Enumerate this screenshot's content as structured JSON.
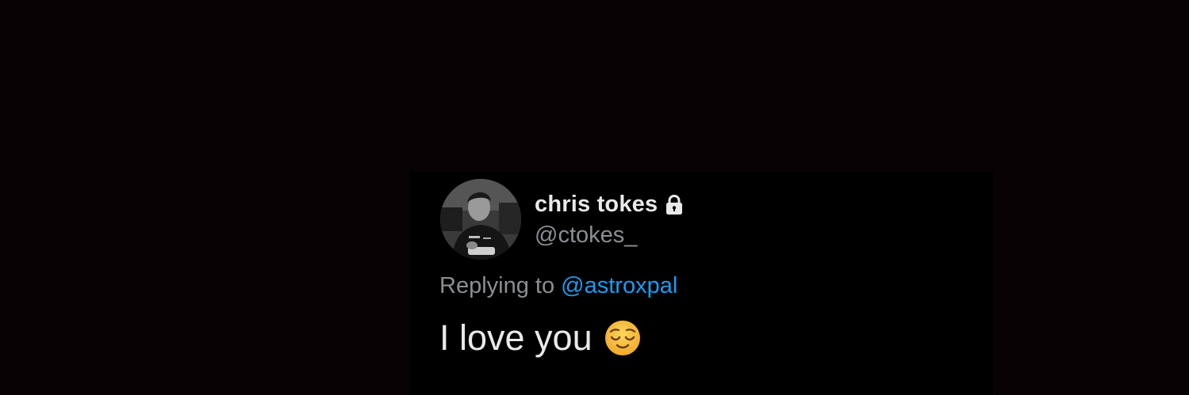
{
  "tweet": {
    "display_name": "chris tokes",
    "handle": "@ctokes_",
    "reply_prefix": "Replying to",
    "reply_mention": "@astroxpal",
    "text": "I love you",
    "emoji": "relieved-face-icon",
    "account_protected": true
  },
  "colors": {
    "background": "#070203",
    "card": "#000000",
    "primary_text": "#e9e9e9",
    "secondary_text": "#8b8f94",
    "link": "#1d9bf0",
    "emoji_face": "#f5c13a"
  },
  "icons": {
    "avatar": "avatar",
    "lock": "lock-icon"
  }
}
